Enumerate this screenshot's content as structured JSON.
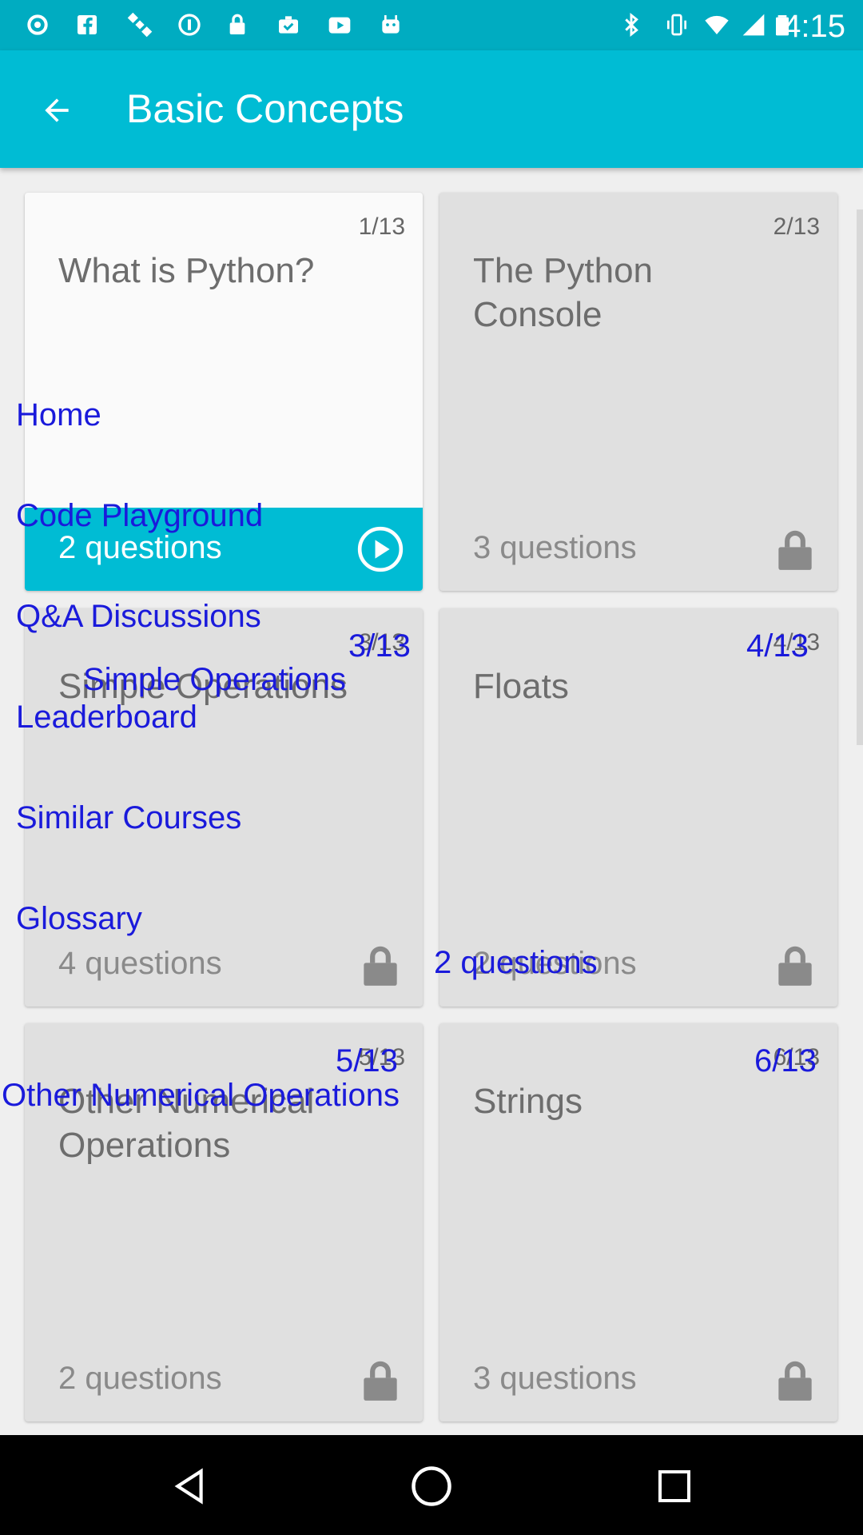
{
  "status_bar": {
    "time": "4:15",
    "icons": [
      "notification-dot-icon",
      "facebook-icon",
      "satellite-icon",
      "info-circle-icon",
      "lock-icon",
      "briefcase-check-icon",
      "youtube-icon",
      "android-icon",
      "bluetooth-icon",
      "vibrate-icon",
      "wifi-icon",
      "signal-icon",
      "battery-icon"
    ]
  },
  "app_bar": {
    "title": "Basic Concepts",
    "back_icon": "back-arrow-icon"
  },
  "lessons": [
    {
      "counter": "1/13",
      "title": "What is Python?",
      "questions": "2 questions",
      "state": "unlocked",
      "icon": "play-circle-icon"
    },
    {
      "counter": "2/13",
      "title": "The Python Console",
      "questions": "3 questions",
      "state": "locked",
      "icon": "lock-icon"
    },
    {
      "counter": "3/13",
      "title": "Simple Operations",
      "questions": "4 questions",
      "state": "locked",
      "icon": "lock-icon"
    },
    {
      "counter": "4/13",
      "title": "Floats",
      "questions": "2 questions",
      "state": "locked",
      "icon": "lock-icon"
    },
    {
      "counter": "5/13",
      "title": "Other Numerical Operations",
      "questions": "2 questions",
      "state": "locked",
      "icon": "lock-icon"
    },
    {
      "counter": "6/13",
      "title": "Strings",
      "questions": "3 questions",
      "state": "locked",
      "icon": "lock-icon"
    }
  ],
  "drawer_items": [
    "Home",
    "Code Playground",
    "Q&A Discussions",
    "Leaderboard",
    "Similar Courses",
    "Glossary"
  ],
  "overlay_labels": {
    "c3_counter": "3/13",
    "c3_title": "Simple Operations",
    "c4_counter": "4/13",
    "c4_questions": "2 questions",
    "c5_counter": "5/13",
    "c5_title": "Other Numerical Operations",
    "c6_counter": "6/13"
  },
  "colors": {
    "status_bar": "#00acc1",
    "app_bar": "#00bcd4",
    "card_locked": "#e0e0e0",
    "card_active": "#fafafa",
    "overlay_text": "#1a1adb"
  },
  "nav_bar": {
    "back": "nav-back-triangle-icon",
    "home": "nav-home-circle-icon",
    "recents": "nav-recents-square-icon"
  }
}
